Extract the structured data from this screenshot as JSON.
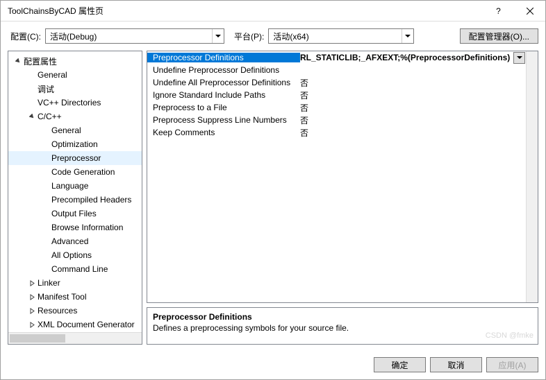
{
  "window": {
    "title": "ToolChainsByCAD 属性页",
    "help": "?",
    "close": "×"
  },
  "toprow": {
    "config_label": "配置(C):",
    "config_value": "活动(Debug)",
    "platform_label": "平台(P):",
    "platform_value": "活动(x64)",
    "manager_label": "配置管理器(O)..."
  },
  "tree": [
    {
      "label": "配置属性",
      "depth": 0,
      "exp": "open"
    },
    {
      "label": "General",
      "depth": 1
    },
    {
      "label": "调试",
      "depth": 1
    },
    {
      "label": "VC++ Directories",
      "depth": 1
    },
    {
      "label": "C/C++",
      "depth": 1,
      "exp": "open"
    },
    {
      "label": "General",
      "depth": 2
    },
    {
      "label": "Optimization",
      "depth": 2
    },
    {
      "label": "Preprocessor",
      "depth": 2,
      "sel": true
    },
    {
      "label": "Code Generation",
      "depth": 2
    },
    {
      "label": "Language",
      "depth": 2
    },
    {
      "label": "Precompiled Headers",
      "depth": 2
    },
    {
      "label": "Output Files",
      "depth": 2
    },
    {
      "label": "Browse Information",
      "depth": 2
    },
    {
      "label": "Advanced",
      "depth": 2
    },
    {
      "label": "All Options",
      "depth": 2
    },
    {
      "label": "Command Line",
      "depth": 2
    },
    {
      "label": "Linker",
      "depth": 1,
      "exp": "closed"
    },
    {
      "label": "Manifest Tool",
      "depth": 1,
      "exp": "closed"
    },
    {
      "label": "Resources",
      "depth": 1,
      "exp": "closed"
    },
    {
      "label": "XML Document Generator",
      "depth": 1,
      "exp": "closed"
    }
  ],
  "grid": [
    {
      "name": "Preprocessor Definitions",
      "value": "RL_STATICLIB;_AFXEXT;%(PreprocessorDefinitions)",
      "sel": true
    },
    {
      "name": "Undefine Preprocessor Definitions",
      "value": ""
    },
    {
      "name": "Undefine All Preprocessor Definitions",
      "value": "否"
    },
    {
      "name": "Ignore Standard Include Paths",
      "value": "否"
    },
    {
      "name": "Preprocess to a File",
      "value": "否"
    },
    {
      "name": "Preprocess Suppress Line Numbers",
      "value": "否"
    },
    {
      "name": "Keep Comments",
      "value": "否"
    }
  ],
  "desc": {
    "title": "Preprocessor Definitions",
    "text": "Defines a preprocessing symbols for your source file."
  },
  "buttons": {
    "ok": "确定",
    "cancel": "取消",
    "apply": "应用(A)"
  },
  "watermark": "CSDN @fmke"
}
